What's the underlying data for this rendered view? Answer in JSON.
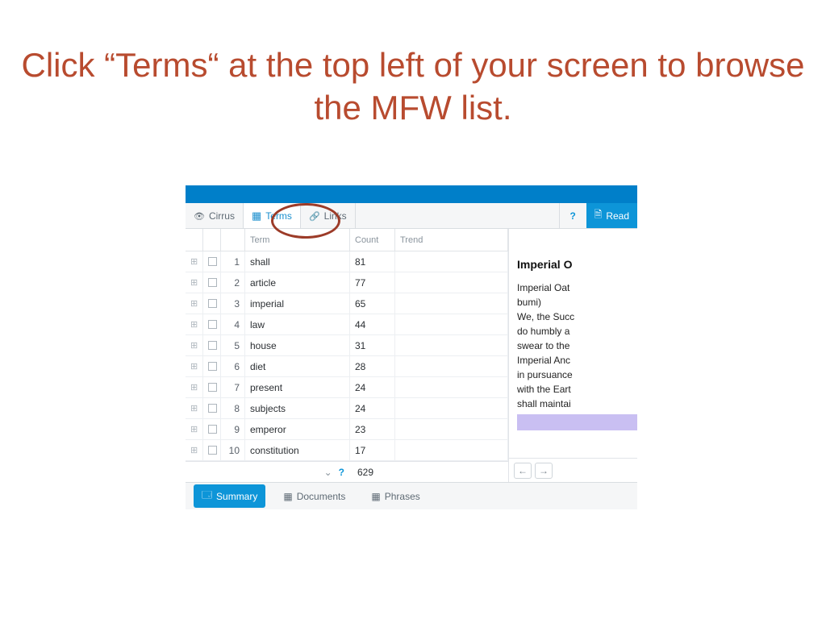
{
  "headline": "Click “Terms“ at the top left of your screen to browse the MFW list.",
  "top_tabs": {
    "cirrus": "Cirrus",
    "terms": "Terms",
    "links": "Links",
    "help": "?",
    "reader": "Read"
  },
  "columns": {
    "term": "Term",
    "count": "Count",
    "trend": "Trend"
  },
  "rows": [
    {
      "rank": "1",
      "term": "shall",
      "count": "81"
    },
    {
      "rank": "2",
      "term": "article",
      "count": "77"
    },
    {
      "rank": "3",
      "term": "imperial",
      "count": "65"
    },
    {
      "rank": "4",
      "term": "law",
      "count": "44"
    },
    {
      "rank": "5",
      "term": "house",
      "count": "31"
    },
    {
      "rank": "6",
      "term": "diet",
      "count": "28"
    },
    {
      "rank": "7",
      "term": "present",
      "count": "24"
    },
    {
      "rank": "8",
      "term": "subjects",
      "count": "24"
    },
    {
      "rank": "9",
      "term": "emperor",
      "count": "23"
    },
    {
      "rank": "10",
      "term": "constitution",
      "count": "17"
    }
  ],
  "footer": {
    "chevron": "⌄",
    "help": "?",
    "total": "629"
  },
  "reader": {
    "title": "Imperial O",
    "lines": [
      "Imperial Oat",
      "bumi)",
      "We, the Succ",
      "do humbly a",
      "swear to the",
      "Imperial Anc",
      "in pursuance",
      "with the Eart",
      "shall maintai"
    ],
    "prev": "←",
    "next": "→"
  },
  "bottom_tabs": {
    "summary": "Summary",
    "documents": "Documents",
    "phrases": "Phrases"
  }
}
